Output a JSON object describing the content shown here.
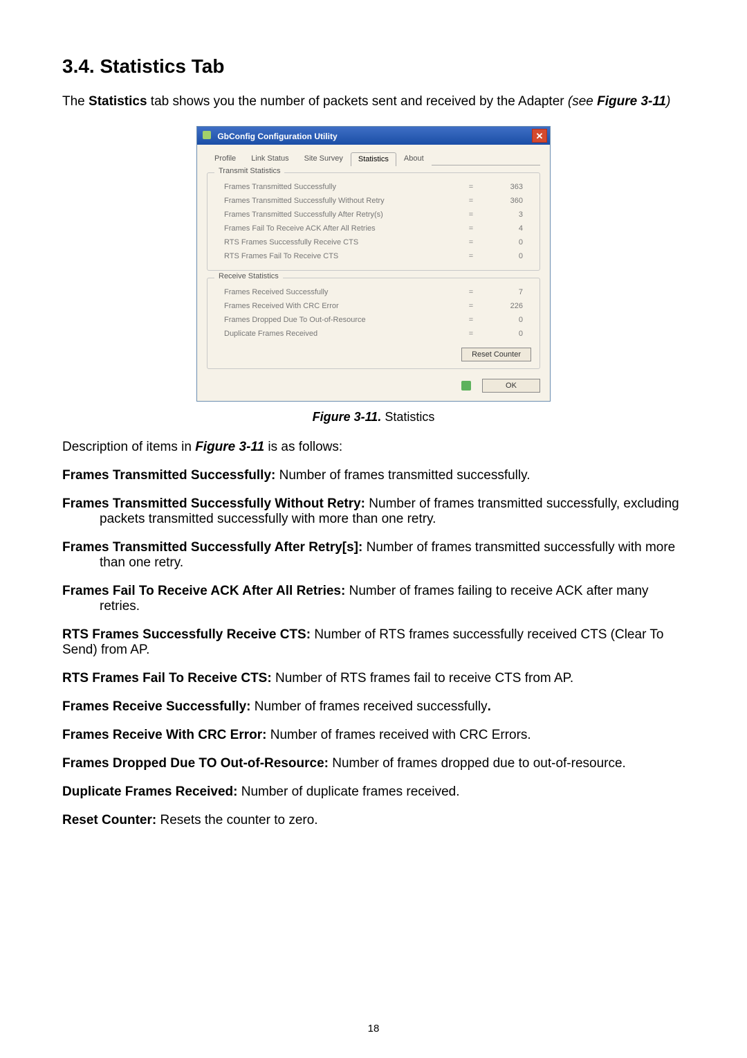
{
  "heading": "3.4. Statistics Tab",
  "intro": {
    "pre": "The ",
    "bold": "Statistics",
    "mid": " tab shows you the number of packets sent and received by the Adapter ",
    "tail_i_open": "(see ",
    "tail_bi": "Figure 3-11",
    "tail_i_close": ")"
  },
  "window": {
    "title": "GbConfig Configuration Utility",
    "tabs": [
      "Profile",
      "Link Status",
      "Site Survey",
      "Statistics",
      "About"
    ],
    "tab_selected_index": 3,
    "group1": "Transmit Statistics",
    "group2": "Receive Statistics",
    "reset_btn": "Reset Counter",
    "ok_btn": "OK",
    "eq": "=",
    "transmit": [
      {
        "label": "Frames Transmitted Successfully",
        "value": "363"
      },
      {
        "label": "Frames Transmitted Successfully  Without Retry",
        "value": "360"
      },
      {
        "label": "Frames Transmitted Successfully After Retry(s)",
        "value": "3"
      },
      {
        "label": "Frames Fail To Receive ACK After All Retries",
        "value": "4"
      },
      {
        "label": "RTS Frames Successfully Receive CTS",
        "value": "0"
      },
      {
        "label": "RTS Frames Fail To Receive CTS",
        "value": "0"
      }
    ],
    "receive": [
      {
        "label": "Frames Received Successfully",
        "value": "7"
      },
      {
        "label": "Frames Received With CRC Error",
        "value": "226"
      },
      {
        "label": "Frames Dropped Due To Out-of-Resource",
        "value": "0"
      },
      {
        "label": "Duplicate Frames Received",
        "value": "0"
      }
    ]
  },
  "caption": {
    "fig": "Figure 3-11.",
    "text": "    Statistics"
  },
  "desc_intro": {
    "pre": "Description of items in ",
    "fig": "Figure 3-11",
    "post": " is as follows:"
  },
  "defs": [
    {
      "term": "Frames Transmitted Successfully:",
      "body": " Number of frames transmitted successfully.",
      "noindent": true
    },
    {
      "term": "Frames Transmitted Successfully Without Retry:",
      "body": " Number of frames transmitted successfully, excluding packets transmitted successfully with more than one retry."
    },
    {
      "term": "Frames Transmitted Successfully After Retry[s]:",
      "body": " Number of frames transmitted successfully with more than one retry."
    },
    {
      "term": "Frames Fail To Receive ACK After All Retries:",
      "body": " Number of frames failing to receive ACK after many retries."
    },
    {
      "term": "RTS Frames Successfully Receive CTS:",
      "body": " Number of RTS frames successfully received CTS (Clear To Send) from AP.",
      "noindent": true
    },
    {
      "term": "RTS Frames Fail To Receive CTS:",
      "body": " Number of RTS frames fail to receive CTS from AP.",
      "noindent": true
    },
    {
      "term": "Frames Receive Successfully:",
      "body": " Number of frames received successfully",
      "noindent": true,
      "trailing_bold_dot": true
    },
    {
      "term": "Frames Receive With CRC Error:",
      "body": " Number of frames received with CRC Errors.",
      "noindent": true
    },
    {
      "term": "Frames Dropped Due TO Out-of-Resource:",
      "body": " Number of frames dropped due to out-of-resource."
    },
    {
      "term": "Duplicate Frames Received:",
      "body": " Number of duplicate frames received.",
      "noindent": true
    },
    {
      "term": "Reset Counter:",
      "body": " Resets the counter to zero.",
      "noindent": true
    }
  ],
  "page_number": "18"
}
